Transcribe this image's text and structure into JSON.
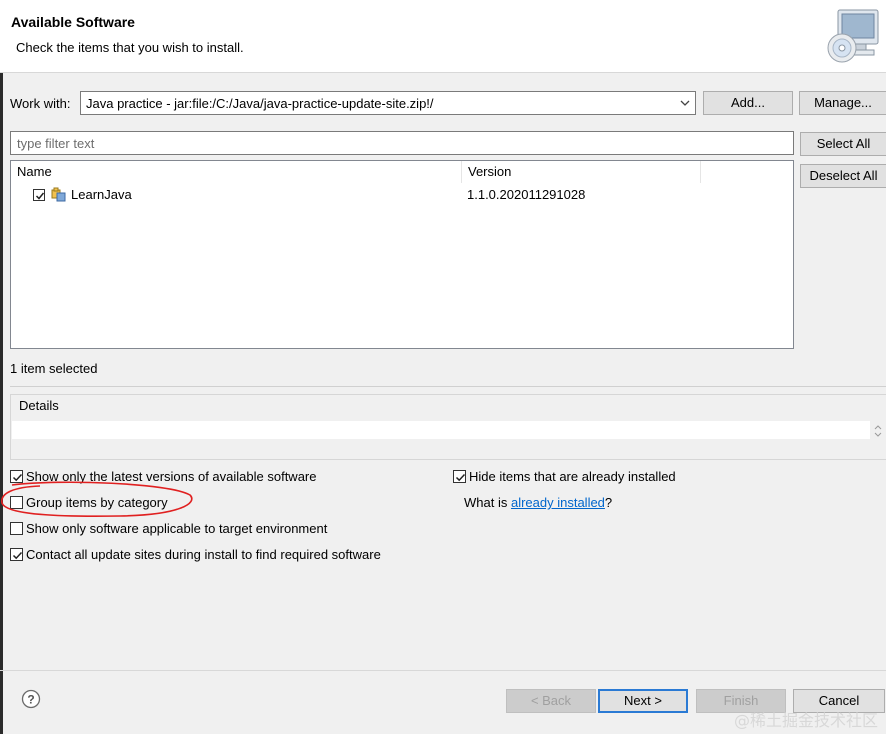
{
  "header": {
    "title": "Available Software",
    "subtitle": "Check the items that you wish to install."
  },
  "work_with": {
    "label": "Work with:",
    "value": "Java practice - jar:file:/C:/Java/java-practice-update-site.zip!/",
    "add_label": "Add...",
    "manage_label": "Manage..."
  },
  "filter": {
    "placeholder": "type filter text"
  },
  "selection_buttons": {
    "select_all": "Select All",
    "deselect_all": "Deselect All"
  },
  "table": {
    "columns": [
      "Name",
      "Version"
    ],
    "rows": [
      {
        "name": "LearnJava",
        "version": "1.1.0.202011291028",
        "checked": true
      }
    ]
  },
  "status": "1 item selected",
  "details": {
    "label": "Details"
  },
  "options": {
    "show_latest": {
      "label": "Show only the latest versions of available software",
      "checked": true
    },
    "group_by_category": {
      "label": "Group items by category",
      "checked": false
    },
    "show_applicable": {
      "label": "Show only software applicable to target environment",
      "checked": false
    },
    "contact_sites": {
      "label": "Contact all update sites during install to find required software",
      "checked": true
    },
    "hide_installed": {
      "label": "Hide items that are already installed",
      "checked": true
    },
    "what_is_prefix": "What is ",
    "what_is_link": "already installed",
    "what_is_suffix": "?"
  },
  "footer": {
    "back": "< Back",
    "next": "Next >",
    "finish": "Finish",
    "cancel": "Cancel"
  },
  "watermark": "@稀土掘金技术社区",
  "colors": {
    "accent": "#2a7ad4",
    "annotation": "#e02020",
    "link": "#0066cc"
  }
}
